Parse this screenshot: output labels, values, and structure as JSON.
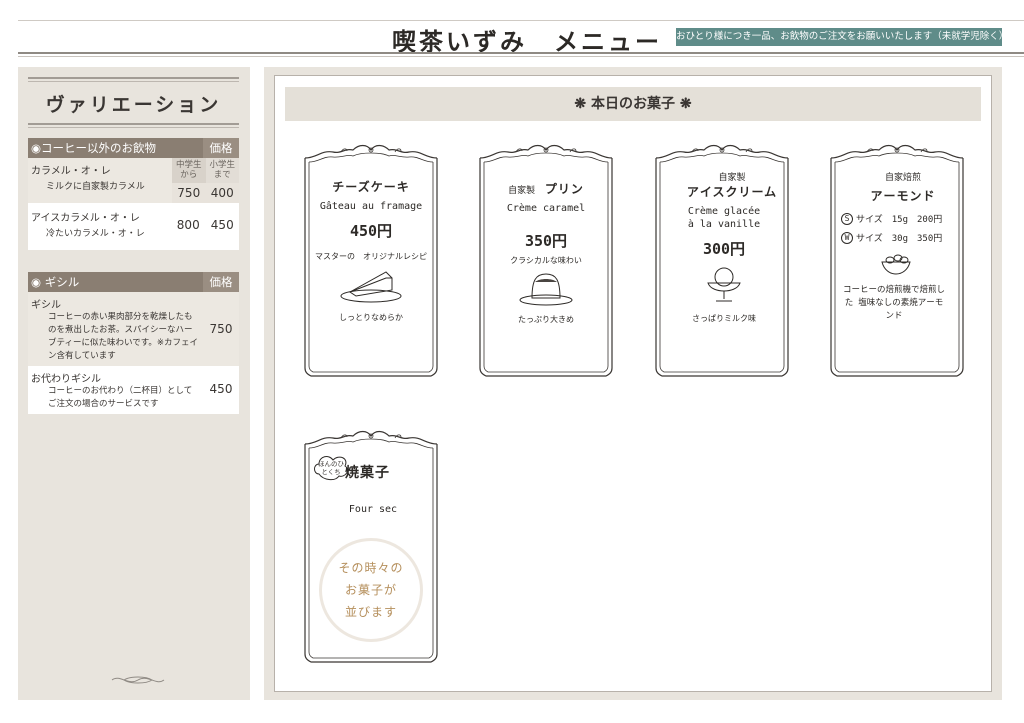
{
  "header": {
    "title": "喫茶いずみ　メニュー",
    "notice": "おひとり様につき一品、お飲物のご注文をお願いいたします（未就学児除く）"
  },
  "left_panel": {
    "title": "ヴァリエーション",
    "section1": {
      "name": "◉コーヒー以外のお飲物",
      "price_header": "価格",
      "age_col1": "中学生から",
      "age_col2": "小学生まで",
      "items": [
        {
          "name": "カラメル・オ・レ",
          "sub": "ミルクに自家製カラメル",
          "price_a": "750",
          "price_b": "400"
        },
        {
          "name": "アイスカラメル・オ・レ",
          "sub": "冷たいカラメル・オ・レ",
          "price_a": "800",
          "price_b": "450"
        }
      ]
    },
    "section2": {
      "name": "◉ ギシル",
      "price_header": "価格",
      "items": [
        {
          "name": "ギシル",
          "desc": "コーヒーの赤い果肉部分を乾燥したものを煮出したお茶。スパイシーなハーブティーに似た味わいです。※カフェイン含有しています",
          "price": "750"
        },
        {
          "name": "お代わりギシル",
          "desc": "コーヒーのお代わり（二杯目）としてご注文の場合のサービスです",
          "price": "450"
        }
      ]
    }
  },
  "right_panel": {
    "banner": "❋ 本日のお菓子 ❋",
    "cards": [
      {
        "title": "チーズケーキ",
        "french": "Gâteau au framage",
        "price": "450円",
        "note1": "マスターの　オリジナルレシピ",
        "note2": "しっとりなめらか"
      },
      {
        "title_prefix": "自家製",
        "title": "プリン",
        "french": "Crème caramel",
        "price": "350円",
        "note1": "クラシカルな味わい",
        "note2": "たっぷり大きめ"
      },
      {
        "title_prefix": "自家製",
        "title": "アイスクリーム",
        "french1": "Crème glacée",
        "french2": "à la vanille",
        "price": "300円",
        "note2": "さっぱりミルク味"
      },
      {
        "title_prefix": "自家焙煎",
        "title": "アーモンド",
        "size_s_label": "S",
        "size_s": "サイズ　15g　200円",
        "size_w_label": "W",
        "size_w": "サイズ　30g　350円",
        "desc": "コーヒーの焙煎機で焙煎した 塩味なしの素焼アーモンド"
      },
      {
        "bubble": "ほんのひとくち",
        "title": "焼菓子",
        "french": "Four sec",
        "stamp1": "その時々の",
        "stamp2": "お菓子が",
        "stamp3": "並びます"
      }
    ]
  },
  "colors": {
    "notice_bg": "#5f8c89",
    "section_head": "#8a7e72",
    "panel_bg": "#e8e4dd",
    "stamp_text": "#b58f5c"
  }
}
